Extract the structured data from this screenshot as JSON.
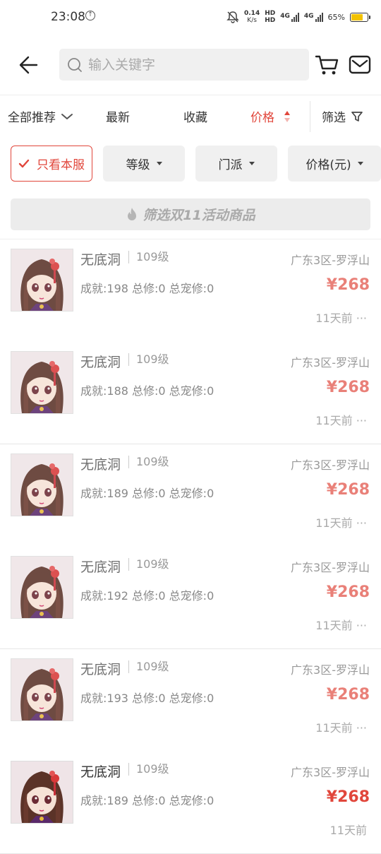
{
  "status_bar": {
    "time": "23:08",
    "speed": "0.14",
    "speed_unit": "K/s",
    "hd1": "HD",
    "hd2": "HD",
    "net1": "4G",
    "net2": "4G",
    "battery": "65%",
    "battery_level": 0.65
  },
  "search": {
    "placeholder": "输入关键字",
    "value": ""
  },
  "sort": {
    "all": "全部推荐",
    "newest": "最新",
    "favorites": "收藏",
    "price": "价格",
    "filter": "筛选"
  },
  "chips": {
    "own_server": "只看本服",
    "level": "等级",
    "school": "门派",
    "price": "价格(元)"
  },
  "banner": {
    "label": "筛选双11活动商品"
  },
  "colors": {
    "accent": "#e1463b",
    "chip_bg": "#f0f0f0"
  },
  "listings": [
    {
      "name": "无底洞",
      "level": "109级",
      "stats": "成就:198 总修:0 总宠修:0",
      "server": "广东3区-罗浮山",
      "price": "¥268",
      "time": "11天前 ···"
    },
    {
      "name": "无底洞",
      "level": "109级",
      "stats": "成就:188 总修:0 总宠修:0",
      "server": "广东3区-罗浮山",
      "price": "¥268",
      "time": "11天前 ···"
    },
    {
      "name": "无底洞",
      "level": "109级",
      "stats": "成就:189 总修:0 总宠修:0",
      "server": "广东3区-罗浮山",
      "price": "¥268",
      "time": "11天前 ···"
    },
    {
      "name": "无底洞",
      "level": "109级",
      "stats": "成就:192 总修:0 总宠修:0",
      "server": "广东3区-罗浮山",
      "price": "¥268",
      "time": "11天前 ···"
    },
    {
      "name": "无底洞",
      "level": "109级",
      "stats": "成就:193 总修:0 总宠修:0",
      "server": "广东3区-罗浮山",
      "price": "¥268",
      "time": "11天前 ···"
    },
    {
      "name": "无底洞",
      "level": "109级",
      "stats": "成就:189 总修:0 总宠修:0",
      "server": "广东3区-罗浮山",
      "price": "¥268",
      "time": "11天前"
    }
  ]
}
